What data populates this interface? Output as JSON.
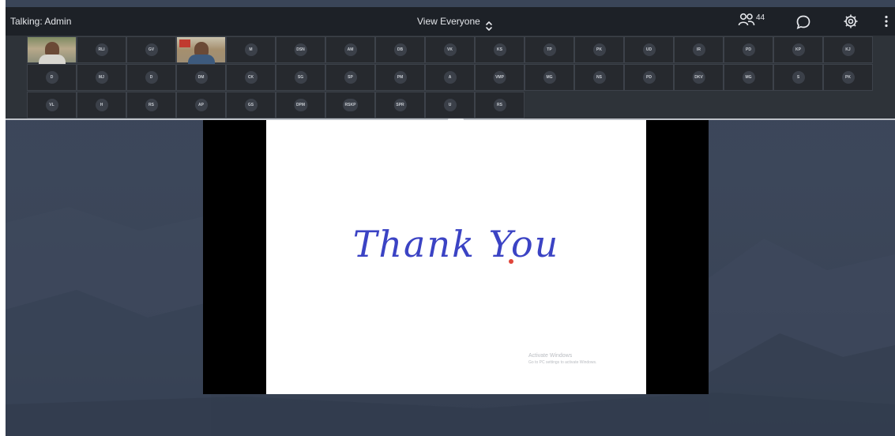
{
  "header": {
    "talking": "Talking: Admin",
    "view_label": "View Everyone",
    "participant_count": "44"
  },
  "grid": {
    "rows": [
      [
        "",
        "RLI",
        "GV",
        "",
        "M",
        "DSN",
        "AM",
        "DB",
        "VK",
        "KS",
        "TP",
        "PK",
        "UD",
        "IR",
        "PD",
        "KP",
        "KJ"
      ],
      [
        "D",
        "MJ",
        "D",
        "DM",
        "CK",
        "SG",
        "SP",
        "PM",
        "A",
        "VMP",
        "MG",
        "NS",
        "PD",
        "DKV",
        "MG",
        "S",
        "PK"
      ],
      [
        "VL",
        "H",
        "RS",
        "AP",
        "GS",
        "DPM",
        "RSKP",
        "SPR",
        "U",
        "RS"
      ]
    ]
  },
  "slide": {
    "text": "Thank You",
    "watermark_title": "Activate Windows",
    "watermark_sub": "Go to PC settings to activate Windows."
  },
  "colors": {
    "topbar": "#1d2127",
    "grid_bg": "#2e3339",
    "stage_bg": "#3a4558",
    "slide_text": "#3b43c4",
    "pointer": "#e0453a"
  },
  "icons": {
    "view_toggle": "chevron-up-down-icon",
    "participants": "people-icon",
    "chat": "chat-bubble-icon",
    "settings": "gear-icon",
    "more": "more-vertical-icon"
  }
}
